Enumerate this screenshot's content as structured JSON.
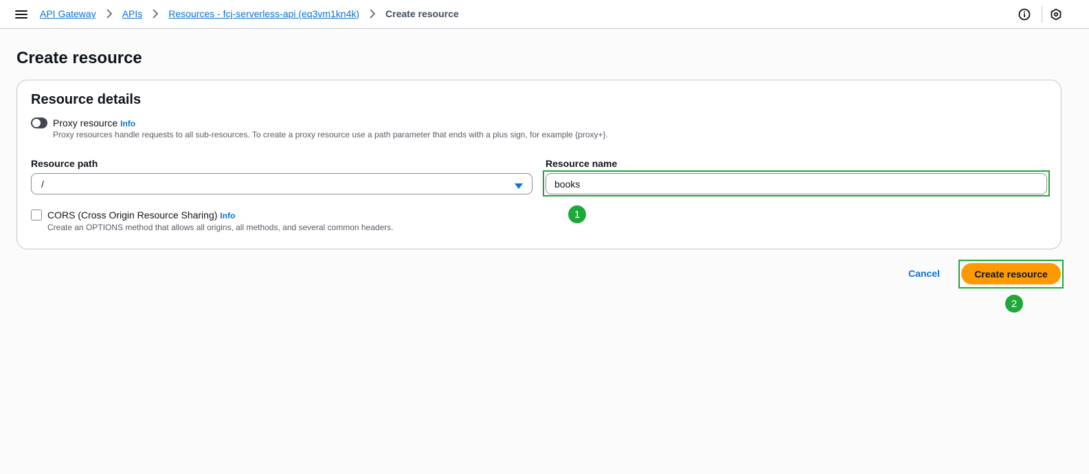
{
  "breadcrumb": {
    "items": [
      "API Gateway",
      "APIs",
      "Resources - fcj-serverless-api (eq3vm1kn4k)"
    ],
    "current": "Create resource"
  },
  "page": {
    "title": "Create resource"
  },
  "panel": {
    "title": "Resource details",
    "proxy": {
      "label": "Proxy resource",
      "info": "Info",
      "description": "Proxy resources handle requests to all sub-resources. To create a proxy resource use a path parameter that ends with a plus sign, for example {proxy+}.",
      "enabled": false
    },
    "resource_path": {
      "label": "Resource path",
      "value": "/"
    },
    "resource_name": {
      "label": "Resource name",
      "value": "books"
    },
    "cors": {
      "label": "CORS (Cross Origin Resource Sharing)",
      "info": "Info",
      "description": "Create an OPTIONS method that allows all origins, all methods, and several common headers.",
      "checked": false
    }
  },
  "actions": {
    "cancel": "Cancel",
    "create": "Create resource"
  },
  "annotations": {
    "step1": "1",
    "step2": "2"
  },
  "colors": {
    "link": "#0972d3",
    "primary_button": "#ff9900",
    "highlight": "#1ea838"
  },
  "icons": [
    "menu-icon",
    "chevron-right-icon",
    "info-circle-icon",
    "settings-hexagon-icon",
    "caret-down-icon"
  ]
}
